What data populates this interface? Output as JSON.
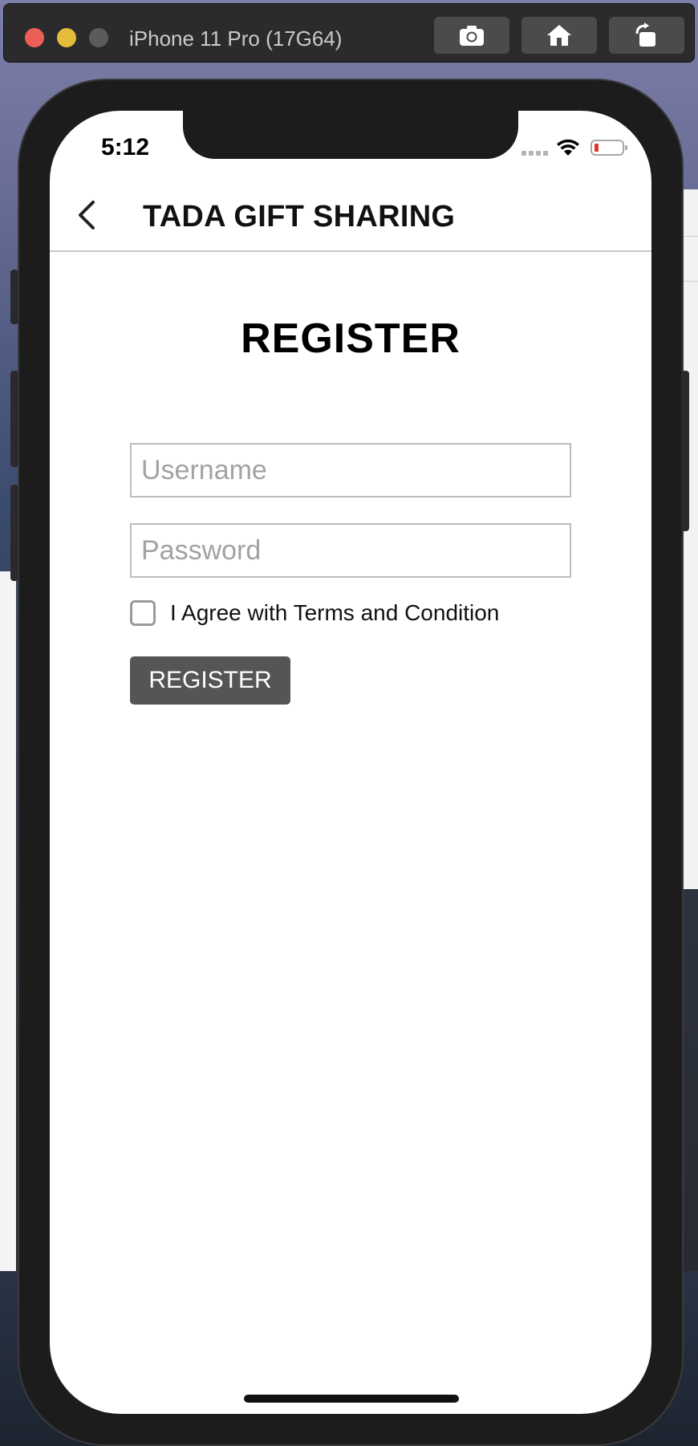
{
  "simulator": {
    "device_title": "iPhone 11 Pro (17G64)",
    "buttons": [
      {
        "name": "screenshot",
        "icon": "camera-icon"
      },
      {
        "name": "home",
        "icon": "home-icon"
      },
      {
        "name": "rotate",
        "icon": "rotate-icon"
      }
    ]
  },
  "status_bar": {
    "time": "5:12",
    "battery_color": "#e5332a"
  },
  "nav": {
    "back_icon": "chevron-left-icon",
    "title": "TADA GIFT SHARING"
  },
  "form": {
    "heading": "REGISTER",
    "username": {
      "value": "",
      "placeholder": "Username"
    },
    "password": {
      "value": "",
      "placeholder": "Password"
    },
    "terms": {
      "checked": false,
      "label": "I Agree with Terms and Condition"
    },
    "submit_label": "REGISTER",
    "submit_color": "#555555"
  }
}
